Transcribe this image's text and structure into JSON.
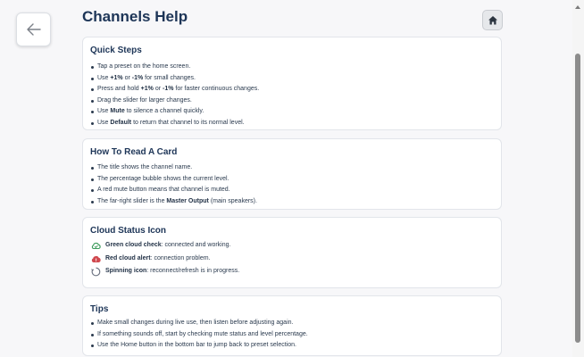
{
  "header": {
    "title": "Channels Help"
  },
  "quick_steps": {
    "title": "Quick Steps",
    "items": [
      [
        {
          "t": "Tap a preset on the home screen."
        }
      ],
      [
        {
          "t": "Use "
        },
        {
          "t": "+1%",
          "b": true
        },
        {
          "t": " or "
        },
        {
          "t": "-1%",
          "b": true
        },
        {
          "t": " for small changes."
        }
      ],
      [
        {
          "t": "Press and hold "
        },
        {
          "t": "+1%",
          "b": true
        },
        {
          "t": " or "
        },
        {
          "t": "-1%",
          "b": true
        },
        {
          "t": " for faster continuous changes."
        }
      ],
      [
        {
          "t": "Drag the slider for larger changes."
        }
      ],
      [
        {
          "t": "Use "
        },
        {
          "t": "Mute",
          "b": true
        },
        {
          "t": " to silence a channel quickly."
        }
      ],
      [
        {
          "t": "Use "
        },
        {
          "t": "Default",
          "b": true
        },
        {
          "t": " to return that channel to its normal level."
        }
      ]
    ]
  },
  "read_card": {
    "title": "How To Read A Card",
    "items": [
      [
        {
          "t": "The title shows the channel name."
        }
      ],
      [
        {
          "t": "The percentage bubble shows the current level."
        }
      ],
      [
        {
          "t": "A red mute button means that channel is muted."
        }
      ],
      [
        {
          "t": "The far-right slider is the "
        },
        {
          "t": "Master Output",
          "b": true
        },
        {
          "t": " (main speakers)."
        }
      ]
    ]
  },
  "cloud_status": {
    "title": "Cloud Status Icon",
    "items": [
      {
        "icon": "cloud-check-icon",
        "color": "#3d9b5c",
        "label": "Green cloud check",
        "desc": ": connected and working."
      },
      {
        "icon": "cloud-alert-icon",
        "color": "#d0494f",
        "label": "Red cloud alert",
        "desc": ": connection problem."
      },
      {
        "icon": "spinner-icon",
        "color": "#6b7280",
        "label": "Spinning icon",
        "desc": ": reconnect/refresh is in progress."
      }
    ]
  },
  "tips": {
    "title": "Tips",
    "items": [
      [
        {
          "t": "Make small changes during live use, then listen before adjusting again."
        }
      ],
      [
        {
          "t": "If something sounds off, start by checking mute status and level percentage."
        }
      ],
      [
        {
          "t": "Use the Home button in the bottom bar to jump back to preset selection."
        }
      ]
    ]
  }
}
